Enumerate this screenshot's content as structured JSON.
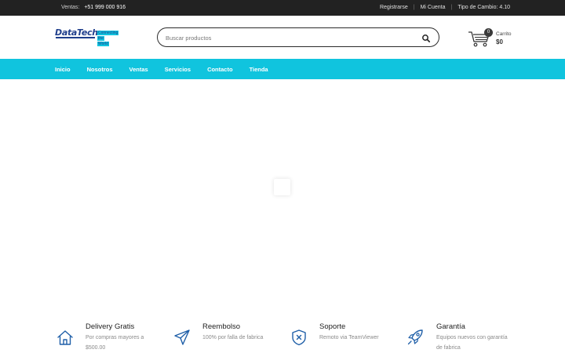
{
  "topbar": {
    "sales_label": "Ventas:",
    "sales_phone": "+51 999 000 916",
    "links": [
      "Registrarse",
      "Mi Cuenta",
      "Tipo de Cambio: 4.10"
    ]
  },
  "header": {
    "logo": {
      "brand": "DataTech",
      "tagline": [
        "Connecting",
        "the",
        "World"
      ]
    },
    "search": {
      "placeholder": "Buscar productos",
      "value": ""
    },
    "cart": {
      "count": "0",
      "label": "Carrito",
      "total": "$0"
    }
  },
  "nav": {
    "items": [
      "Inicio",
      "Nosotros",
      "Ventas",
      "Servicios",
      "Contacto",
      "Tienda"
    ]
  },
  "features": [
    {
      "icon": "home-icon",
      "title": "Delivery Gratis",
      "desc": "Por compras mayores a $500.00"
    },
    {
      "icon": "paper-plane-icon",
      "title": "Reembolso",
      "desc": "100% por falla de fabrica"
    },
    {
      "icon": "shield-icon",
      "title": "Soporte",
      "desc": "Remoto via TeamViewer"
    },
    {
      "icon": "rocket-icon",
      "title": "Garantía",
      "desc": "Equipos nuevos con garantía de fabrica"
    }
  ],
  "colors": {
    "accent": "#10c4de",
    "topbar_bg": "#222222",
    "brand_blue": "#1f3e8c",
    "icon_blue": "#1f5fa8"
  }
}
